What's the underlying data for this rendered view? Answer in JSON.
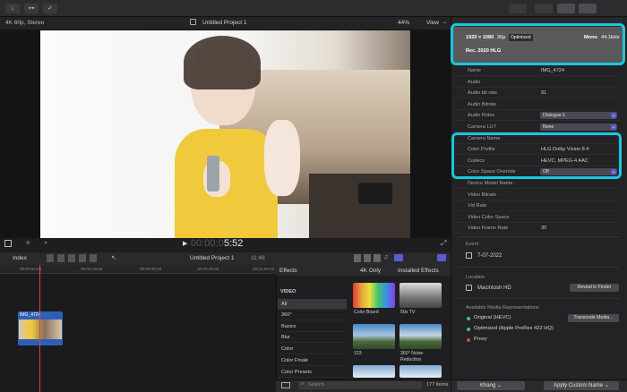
{
  "toolbar": {
    "left_icons": [
      "↓",
      "⊶",
      "✓"
    ]
  },
  "viewer": {
    "format": "4K 60p, Stereo",
    "project_title": "Untitled Project 1",
    "zoom": "44%",
    "view_label": "View",
    "timecode_dim": "00:00:0",
    "timecode": "5:52"
  },
  "inspector_header": {
    "resolution": "1920 × 1080",
    "fps": "30p",
    "badge": "Optimized",
    "audio": "Mono",
    "audio_rate": "44.1kHz",
    "color_space": "Rec. 2020 HLG"
  },
  "inspector_rows": [
    {
      "k": "Name",
      "v": "IMG_4724",
      "type": "text"
    },
    {
      "k": "Audio",
      "v": "",
      "type": "text"
    },
    {
      "k": "Audio bit rate",
      "v": "91",
      "type": "text"
    },
    {
      "k": "Audio Bitrate",
      "v": "",
      "type": "text"
    },
    {
      "k": "Audio Roles",
      "v": "Dialogue-1",
      "type": "select"
    },
    {
      "k": "Camera LUT",
      "v": "None",
      "type": "select"
    },
    {
      "k": "Camera Name",
      "v": "",
      "type": "text"
    },
    {
      "k": "Color Profile",
      "v": "HLG Dolby Vision 8.4",
      "type": "text"
    },
    {
      "k": "Codecs",
      "v": "HEVC, MPEG-4 AAC",
      "type": "text"
    },
    {
      "k": "Color Space Override",
      "v": "Off",
      "type": "select"
    },
    {
      "k": "Device Model Name",
      "v": "",
      "type": "text"
    },
    {
      "k": "Video Bitrate",
      "v": "",
      "type": "text"
    },
    {
      "k": "Vid Rate",
      "v": "",
      "type": "text"
    },
    {
      "k": "Video Color Space",
      "v": "",
      "type": "text"
    },
    {
      "k": "Video Frame Rate",
      "v": "30",
      "type": "text"
    }
  ],
  "event": {
    "label": "Event",
    "date": "7-07-2022"
  },
  "location": {
    "label": "Location",
    "value": "Macintosh HD",
    "reveal": "Reveal in Finder"
  },
  "representations": {
    "label": "Available Media Representations",
    "items": [
      {
        "name": "Original (HEVC)",
        "color": "#3ec46d"
      },
      {
        "name": "Optimized (Apple ProRes 422 HQ)",
        "color": "#3ec46d"
      },
      {
        "name": "Proxy",
        "color": "#e0453a"
      }
    ],
    "transcode": "Transcode Media..."
  },
  "bottom_bar": {
    "user": "Khang",
    "apply": "Apply Custom Name"
  },
  "timeline": {
    "index_label": "Index",
    "project_title": "Untitled Project 1",
    "duration": "11:48",
    "ruler": [
      "00:00:00:00",
      "00:00:15:00",
      "00:00:30:00",
      "00:00:45:00",
      "00:01:00:00"
    ],
    "clip_name": "IMG_4724"
  },
  "effects": {
    "title": "Effects",
    "filter_4k": "4K Only",
    "installed": "Installed Effects",
    "section": "VIDEO",
    "categories": [
      "All",
      "360°",
      "Basics",
      "Blur",
      "Color",
      "Color Finale",
      "Color Presets"
    ],
    "thumbs": [
      {
        "label": "Color Board"
      },
      {
        "label": "50s TV"
      },
      {
        "label": "123"
      },
      {
        "label": "360° Noise\nReduction"
      }
    ],
    "search_placeholder": "Search",
    "items_count": "177 items"
  },
  "colors": {
    "accent": "#5b5bd6",
    "highlight": "#18c8df",
    "playhead": "#e0453a",
    "clip": "#2e5fb8"
  }
}
